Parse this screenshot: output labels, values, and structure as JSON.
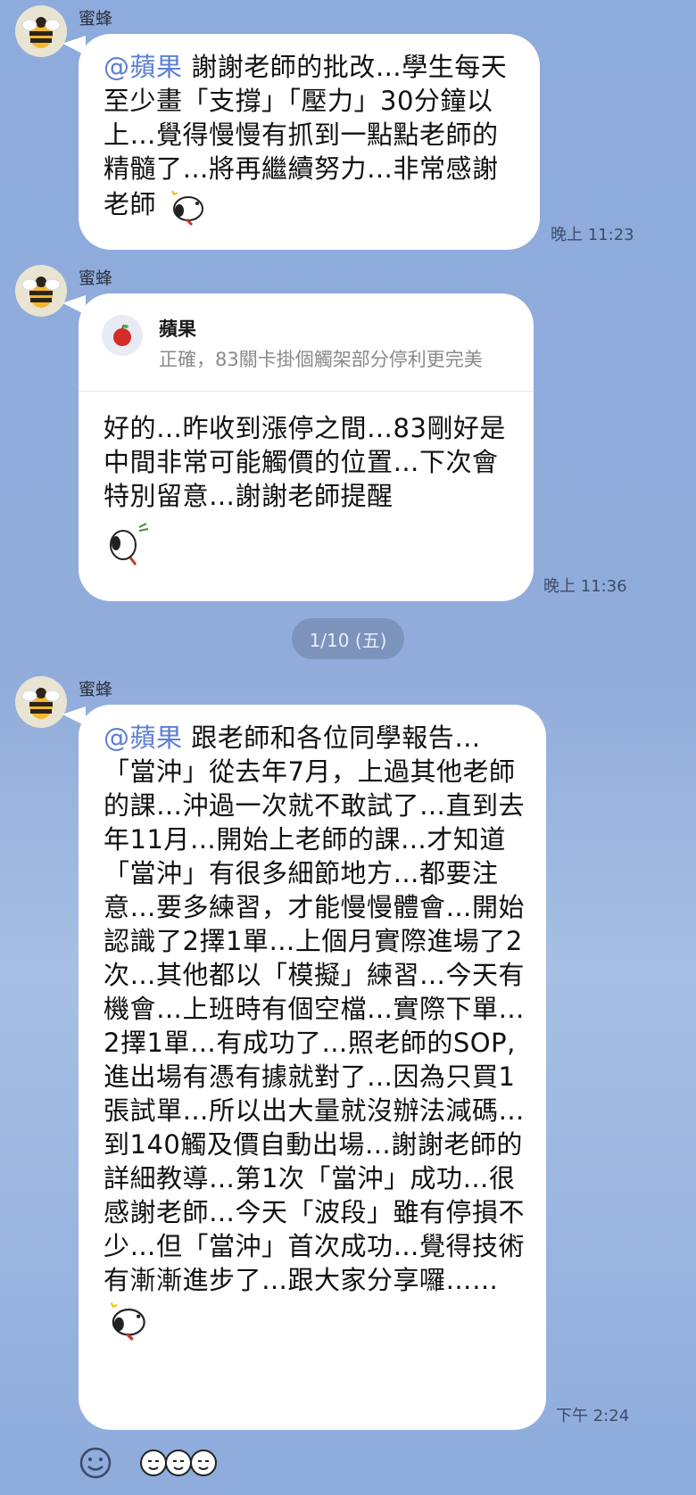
{
  "messages": [
    {
      "sender": "蜜蜂",
      "mention": "@蘋果",
      "text": " 謝謝老師的批改…學生每天至少畫「支撐」「壓力」30分鐘以上…覺得慢慢有抓到一點點老師的精髓了…將再繼續努力…非常感謝老師",
      "time": "晚上 11:23"
    },
    {
      "sender": "蜜蜂",
      "reply_name": "蘋果",
      "reply_quote": "正確，83關卡掛個觸架部分停利更完美",
      "text": "好的…昨收到漲停之間…83剛好是中間非常可能觸價的位置…下次會特別留意…謝謝老師提醒",
      "time": "晚上 11:36"
    },
    {
      "sender": "蜜蜂",
      "mention": "@蘋果",
      "text": " 跟老師和各位同學報告…「當沖」從去年7月，上過其他老師的課…沖過一次就不敢試了…直到去年11月…開始上老師的課…才知道「當沖」有很多細節地方…都要注意…要多練習，才能慢慢體會…開始認識了2擇1單…上個月實際進場了2次…其他都以「模擬」練習…今天有機會…上班時有個空檔…實際下單…2擇1單…有成功了…照老師的SOP,進出場有憑有據就對了…因為只買1張試單…所以出大量就沒辦法減碼…到140觸及價自動出場…謝謝老師的詳細教導…第1次「當沖」成功…很感謝老師…今天「波段」雖有停損不少…但「當沖」首次成功…覺得技術有漸漸進步了…跟大家分享囉……",
      "time": "下午 2:24"
    }
  ],
  "date_separator": "1/10 (五)",
  "colors": {
    "background": "#8fabdc",
    "bubble": "#ffffff",
    "mention": "#5d7fd4",
    "date_pill": "#7c93bc"
  },
  "icons": {
    "avatar": "bee-avatar-icon",
    "reply_avatar": "apple-icon",
    "emoji_button": "smiley-icon",
    "reaction": "sticker-faces-icon"
  }
}
